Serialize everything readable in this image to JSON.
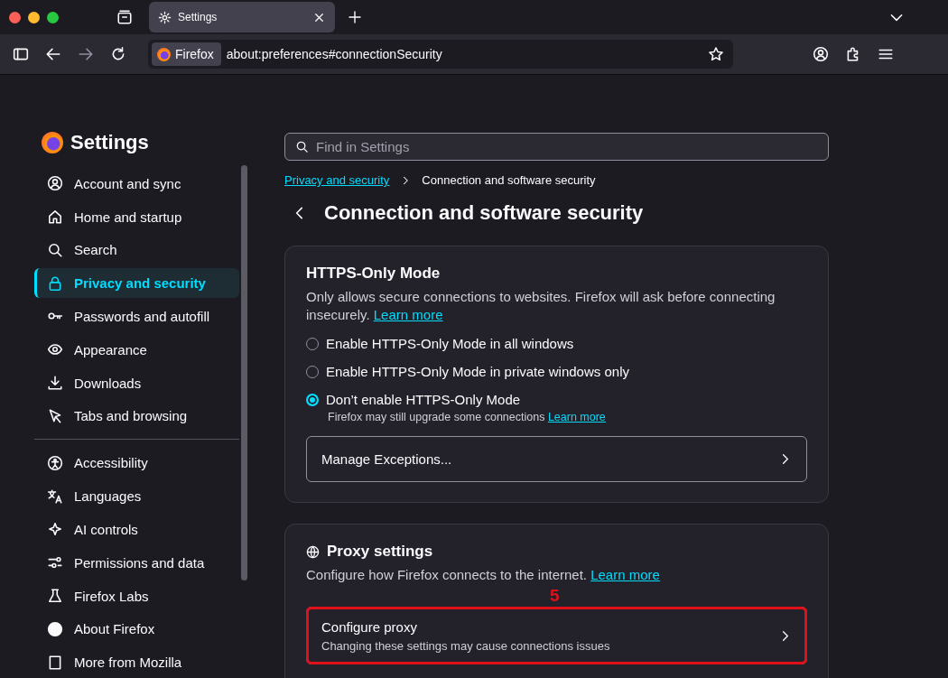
{
  "tabs": [
    {
      "label": "Settings",
      "selected": true
    }
  ],
  "toolbar": {
    "identity": "Firefox",
    "url": "about:preferences#connectionSecurity"
  },
  "sidebar": {
    "title": "Settings",
    "groups": [
      [
        {
          "label": "Account and sync",
          "selected": false
        },
        {
          "label": "Home and startup",
          "selected": false
        },
        {
          "label": "Search",
          "selected": false
        },
        {
          "label": "Privacy and security",
          "selected": true
        },
        {
          "label": "Passwords and autofill",
          "selected": false
        },
        {
          "label": "Appearance",
          "selected": false
        },
        {
          "label": "Downloads",
          "selected": false
        },
        {
          "label": "Tabs and browsing",
          "selected": false
        }
      ],
      [
        {
          "label": "Accessibility",
          "selected": false
        },
        {
          "label": "Languages",
          "selected": false
        },
        {
          "label": "AI controls",
          "selected": false
        },
        {
          "label": "Permissions and data",
          "selected": false
        },
        {
          "label": "Firefox Labs",
          "selected": false
        },
        {
          "label": "About Firefox",
          "selected": false
        },
        {
          "label": "More from Mozilla",
          "selected": false
        }
      ]
    ]
  },
  "search": {
    "placeholder": "Find in Settings"
  },
  "breadcrumb": {
    "link": "Privacy and security",
    "current": "Connection and software security"
  },
  "page_title": "Connection and software security",
  "https_card": {
    "title": "HTTPS-Only Mode",
    "description": "Only allows secure connections to websites. Firefox will ask before connecting insecurely.",
    "link": "Learn more",
    "options": [
      {
        "label": "Enable HTTPS-Only Mode in all windows",
        "selected": false
      },
      {
        "label": "Enable HTTPS-Only Mode in private windows only",
        "selected": false
      },
      {
        "label": "Don’t enable HTTPS-Only Mode",
        "selected": true,
        "note": "Firefox may still upgrade some connections",
        "note_link": "Learn more"
      }
    ],
    "button": "Manage Exceptions..."
  },
  "proxy_card": {
    "title": "Proxy settings",
    "description": "Configure how Firefox connects to the internet.",
    "link": "Learn more",
    "button": {
      "title": "Configure proxy",
      "subtitle": "Changing these settings may cause connections issues"
    },
    "annotation": "5"
  }
}
